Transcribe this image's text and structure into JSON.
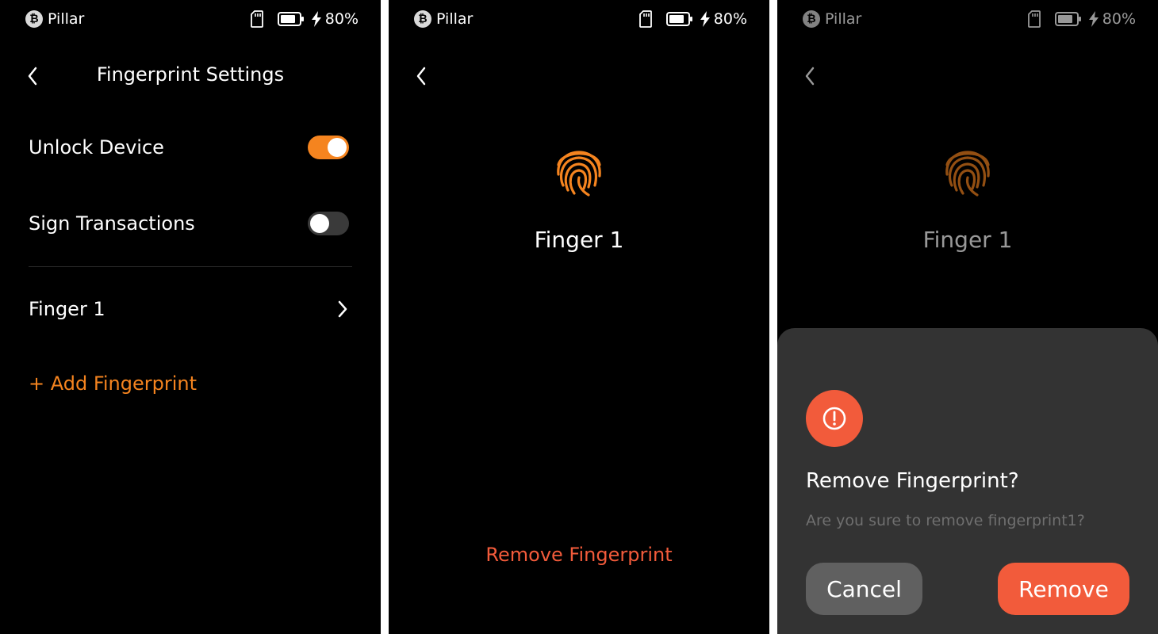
{
  "status_bar": {
    "brand_symbol": "₿",
    "brand_name": "Pillar",
    "battery_percent": "80%",
    "icons": [
      "bitcoin-icon",
      "sd-card-icon",
      "battery-icon",
      "charging-icon"
    ]
  },
  "settings_screen": {
    "title": "Fingerprint Settings",
    "unlock_device": {
      "label": "Unlock Device",
      "enabled": true
    },
    "sign_transactions": {
      "label": "Sign Transactions",
      "enabled": false
    },
    "fingerprints": [
      {
        "label": "Finger 1"
      }
    ],
    "add_fingerprint_label": "+ Add Fingerprint"
  },
  "detail_screen": {
    "finger_name": "Finger 1",
    "remove_label": "Remove Fingerprint"
  },
  "confirm_dialog": {
    "title": "Remove Fingerprint?",
    "message": "Are you sure to remove fingerprint1?",
    "cancel_label": "Cancel",
    "remove_label": "Remove"
  },
  "colors": {
    "accent": "#f5841f",
    "danger": "#f25b3b",
    "background": "#000000",
    "sheet": "#333333"
  }
}
